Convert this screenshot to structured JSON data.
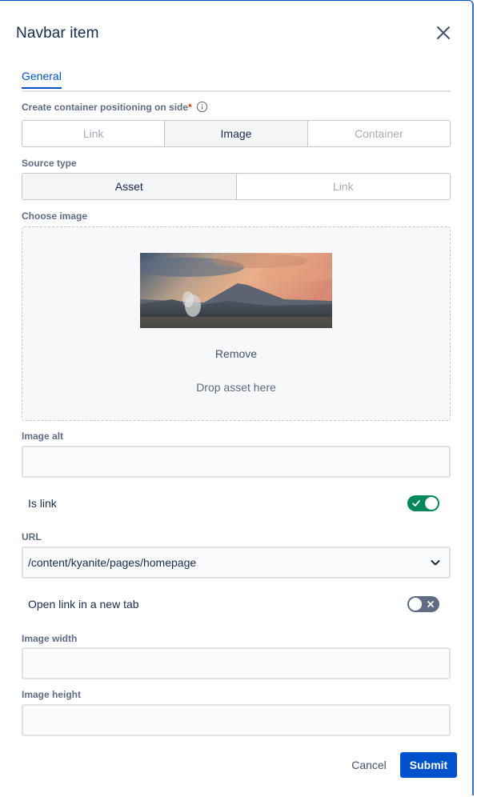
{
  "modal": {
    "title": "Navbar item",
    "close_icon": "close-icon"
  },
  "tabs": [
    {
      "label": "General",
      "active": true
    }
  ],
  "positioning": {
    "label": "Create container positioning on side",
    "required_mark": "*",
    "info_icon": "info-icon",
    "options": [
      "Link",
      "Image",
      "Container"
    ],
    "selected": "Image"
  },
  "source_type": {
    "label": "Source type",
    "options": [
      "Asset",
      "Link"
    ],
    "selected": "Asset"
  },
  "choose_image": {
    "label": "Choose image",
    "remove_label": "Remove",
    "drop_text": "Drop asset here"
  },
  "image_alt": {
    "label": "Image alt",
    "value": ""
  },
  "is_link": {
    "label": "Is link",
    "checked": true
  },
  "url": {
    "label": "URL",
    "value": "/content/kyanite/pages/homepage"
  },
  "new_tab": {
    "label": "Open link in a new tab",
    "checked": false
  },
  "image_width": {
    "label": "Image width",
    "value": ""
  },
  "image_height": {
    "label": "Image height",
    "value": ""
  },
  "footer": {
    "cancel_label": "Cancel",
    "submit_label": "Submit"
  },
  "colors": {
    "accent": "#0052cc",
    "toggle_on": "#00875a",
    "toggle_off": "#5e6c84",
    "required": "#de350b"
  }
}
